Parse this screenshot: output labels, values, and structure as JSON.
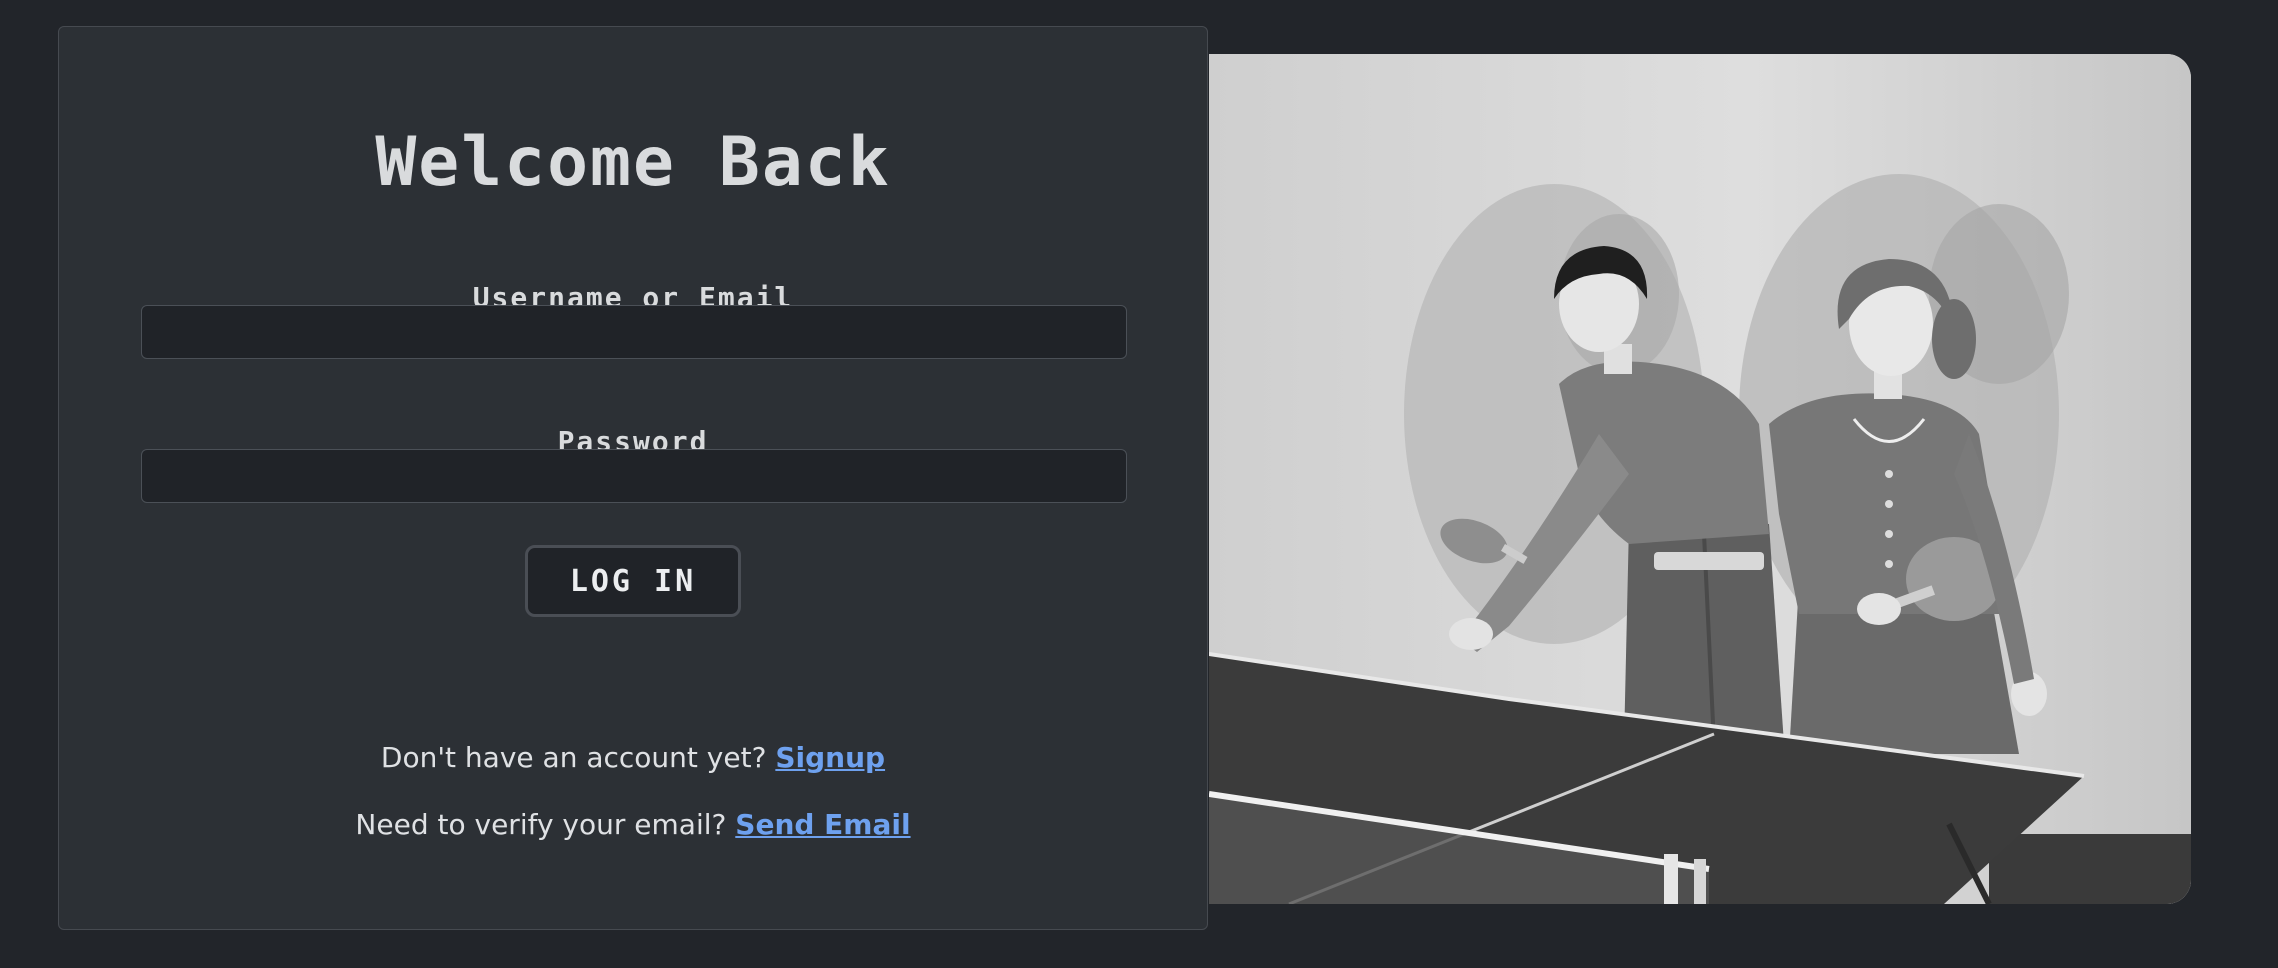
{
  "login": {
    "title": "Welcome Back",
    "username_label": "Username or Email",
    "username_value": "",
    "password_label": "Password",
    "password_value": "",
    "login_button": "LOG IN"
  },
  "footer": {
    "signup_prompt": "Don't have an account yet?",
    "signup_link": "Signup",
    "verify_prompt": "Need to verify your email?",
    "verify_link": "Send Email"
  },
  "photo": {
    "subject": "Black-and-white photo of a young man and woman playing table tennis"
  },
  "colors": {
    "background": "#22252a",
    "card": "#2c3035",
    "input": "#202328",
    "link": "#6ea1ef",
    "text": "#d9dbdd"
  }
}
